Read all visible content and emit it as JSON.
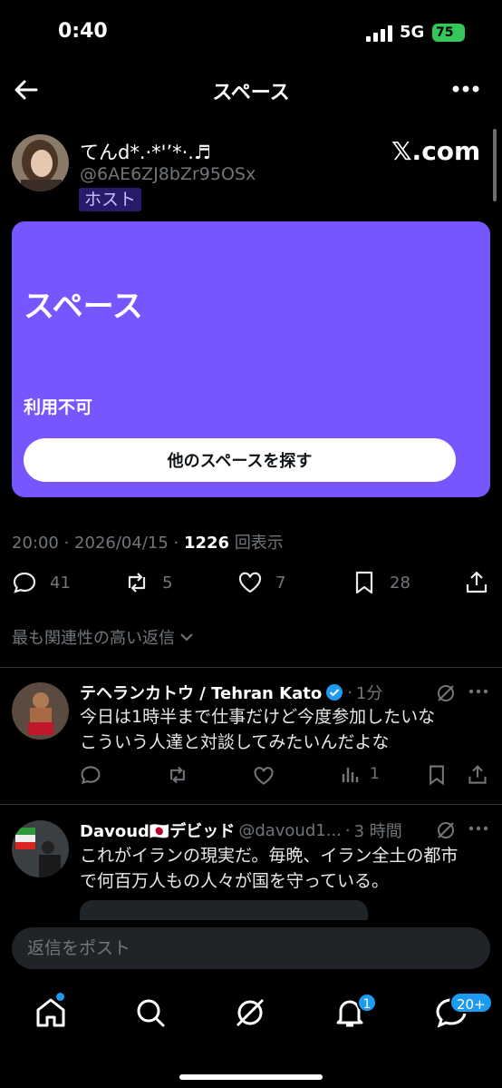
{
  "status_bar": {
    "time": "0:40",
    "network": "5G",
    "battery": "75"
  },
  "header": {
    "title": "スペース"
  },
  "host": {
    "name": "てんd*.·*'’*·.♬",
    "handle": "@6AE6ZJ8bZr95OSx",
    "badge": "ホスト",
    "brand": "𝕏.com"
  },
  "space_card": {
    "title": "スペース",
    "status": "利用不可",
    "button_label": "他のスペースを探す",
    "color": "#7856ff"
  },
  "meta": {
    "time": "20:00",
    "date": "2026/04/15",
    "views": "1226",
    "views_label": "回表示"
  },
  "actions": {
    "replies": "41",
    "reposts": "5",
    "likes": "7",
    "bookmarks": "28"
  },
  "sort_label": "最も関連性の高い返信",
  "replies": [
    {
      "name": "テヘランカトウ / Tehran Kato",
      "time": "1分",
      "text_lines": [
        "今日は1時半まで仕事だけど今度参加したいな",
        "こういう人達と対談してみたいんだよな"
      ],
      "views": "1"
    },
    {
      "name": "Davoud🇯🇵デビッド",
      "handle": "@davoud1...",
      "time": "3 時間",
      "text_lines": [
        "これがイランの現実だ。毎晩、イラン全土の都市",
        "で何百万人もの人々が国を守っている。"
      ]
    }
  ],
  "reply_input": {
    "placeholder": "返信をポスト"
  },
  "tab_bar": {
    "notifications_badge": "1",
    "messages_badge": "20+"
  },
  "colors": {
    "accent": "#1d9bf0",
    "background": "#000000",
    "muted": "#71767b"
  }
}
